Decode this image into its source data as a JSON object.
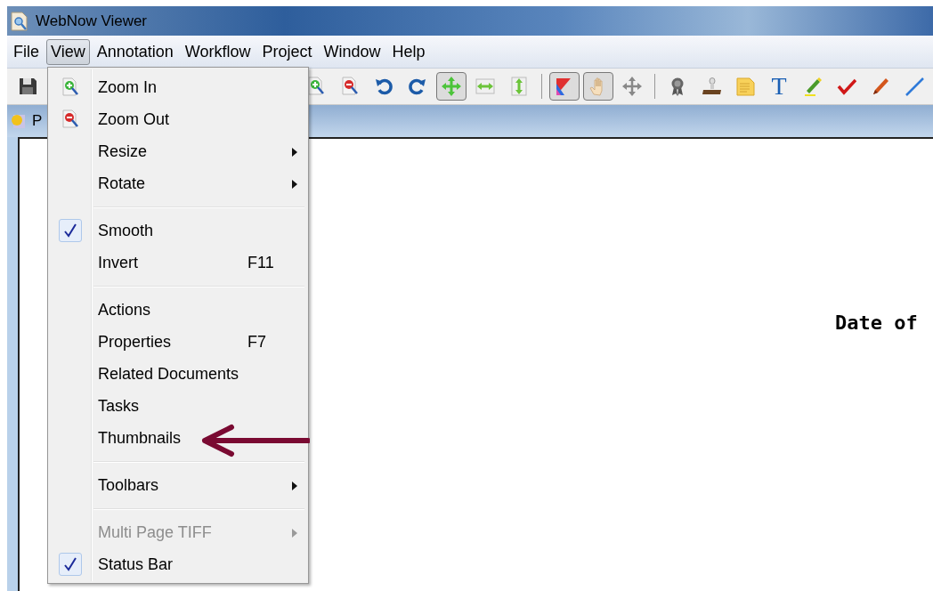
{
  "window": {
    "title": "WebNow Viewer"
  },
  "menubar": [
    {
      "label": "File",
      "selected": false
    },
    {
      "label": "View",
      "selected": true
    },
    {
      "label": "Annotation",
      "selected": false
    },
    {
      "label": "Workflow",
      "selected": false
    },
    {
      "label": "Project",
      "selected": false
    },
    {
      "label": "Window",
      "selected": false
    },
    {
      "label": "Help",
      "selected": false
    }
  ],
  "toolbar": [
    {
      "kind": "button",
      "pressed": false
    },
    {
      "kind": "gap"
    },
    {
      "kind": "button",
      "pressed": false
    },
    {
      "kind": "button",
      "pressed": false
    },
    {
      "kind": "button",
      "pressed": false
    },
    {
      "kind": "button",
      "pressed": false
    },
    {
      "kind": "button",
      "pressed": true
    },
    {
      "kind": "button",
      "pressed": false
    },
    {
      "kind": "button",
      "pressed": false
    },
    {
      "kind": "separator"
    },
    {
      "kind": "button",
      "pressed": true
    },
    {
      "kind": "button",
      "pressed": true
    },
    {
      "kind": "button",
      "pressed": false
    },
    {
      "kind": "separator"
    },
    {
      "kind": "button",
      "pressed": false
    },
    {
      "kind": "button",
      "pressed": false
    },
    {
      "kind": "button",
      "pressed": false
    },
    {
      "kind": "button",
      "pressed": false,
      "glyph": "T"
    },
    {
      "kind": "button",
      "pressed": false
    },
    {
      "kind": "button",
      "pressed": false
    },
    {
      "kind": "button",
      "pressed": false
    },
    {
      "kind": "button",
      "pressed": false
    }
  ],
  "tab": {
    "label": "P"
  },
  "document": {
    "lines": [
      "Date of"
    ]
  },
  "view_menu": [
    {
      "kind": "item",
      "label": "Zoom In",
      "submenu": false,
      "checked": false,
      "disabled": false
    },
    {
      "kind": "item",
      "label": "Zoom Out",
      "submenu": false,
      "checked": false,
      "disabled": false
    },
    {
      "kind": "item",
      "label": "Resize",
      "submenu": true,
      "checked": false,
      "disabled": false
    },
    {
      "kind": "item",
      "label": "Rotate",
      "submenu": true,
      "checked": false,
      "disabled": false
    },
    {
      "kind": "separator"
    },
    {
      "kind": "item",
      "label": "Smooth",
      "submenu": false,
      "checked": true,
      "disabled": false
    },
    {
      "kind": "item",
      "label": "Invert",
      "shortcut": "F11",
      "submenu": false,
      "checked": false,
      "disabled": false
    },
    {
      "kind": "separator"
    },
    {
      "kind": "item",
      "label": "Actions",
      "submenu": false,
      "checked": false,
      "disabled": false
    },
    {
      "kind": "item",
      "label": "Properties",
      "shortcut": "F7",
      "submenu": false,
      "checked": false,
      "disabled": false
    },
    {
      "kind": "item",
      "label": "Related Documents",
      "submenu": false,
      "checked": false,
      "disabled": false
    },
    {
      "kind": "item",
      "label": "Tasks",
      "submenu": false,
      "checked": false,
      "disabled": false
    },
    {
      "kind": "item",
      "label": "Thumbnails",
      "submenu": false,
      "checked": false,
      "disabled": false
    },
    {
      "kind": "separator"
    },
    {
      "kind": "item",
      "label": "Toolbars",
      "submenu": true,
      "checked": false,
      "disabled": false
    },
    {
      "kind": "separator"
    },
    {
      "kind": "item",
      "label": "Multi Page TIFF",
      "submenu": true,
      "checked": false,
      "disabled": true
    },
    {
      "kind": "item",
      "label": "Status Bar",
      "submenu": false,
      "checked": true,
      "disabled": false
    }
  ]
}
